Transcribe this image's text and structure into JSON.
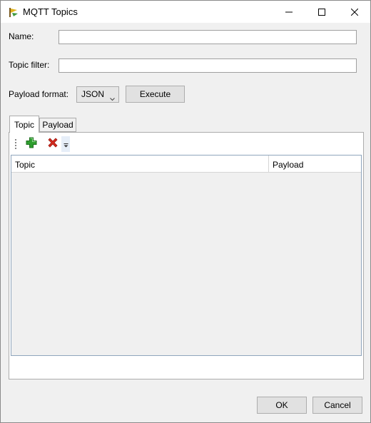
{
  "window": {
    "title": "MQTT Topics",
    "icon": "mqtt-app-icon",
    "controls": [
      "minimize-icon",
      "maximize-icon",
      "close-icon"
    ]
  },
  "form": {
    "name_label": "Name:",
    "name_value": "",
    "topic_filter_label": "Topic filter:",
    "topic_filter_value": "",
    "payload_format_label": "Payload format:",
    "payload_format_value": "JSON",
    "execute_label": "Execute"
  },
  "tabs": [
    {
      "label": "Topic",
      "selected": true
    },
    {
      "label": "Payload",
      "selected": false
    }
  ],
  "toolbar": {
    "add_icon": "add-icon",
    "delete_icon": "delete-icon",
    "overflow_icon": "overflow-icon"
  },
  "grid": {
    "columns": [
      "Topic",
      "Payload"
    ],
    "rows": []
  },
  "footer": {
    "ok_label": "OK",
    "cancel_label": "Cancel"
  },
  "colors": {
    "window_bg": "#f0f0f0",
    "add_green": "#2e9e2e",
    "delete_red": "#d42a1e",
    "grid_border": "#8fa5bd"
  }
}
